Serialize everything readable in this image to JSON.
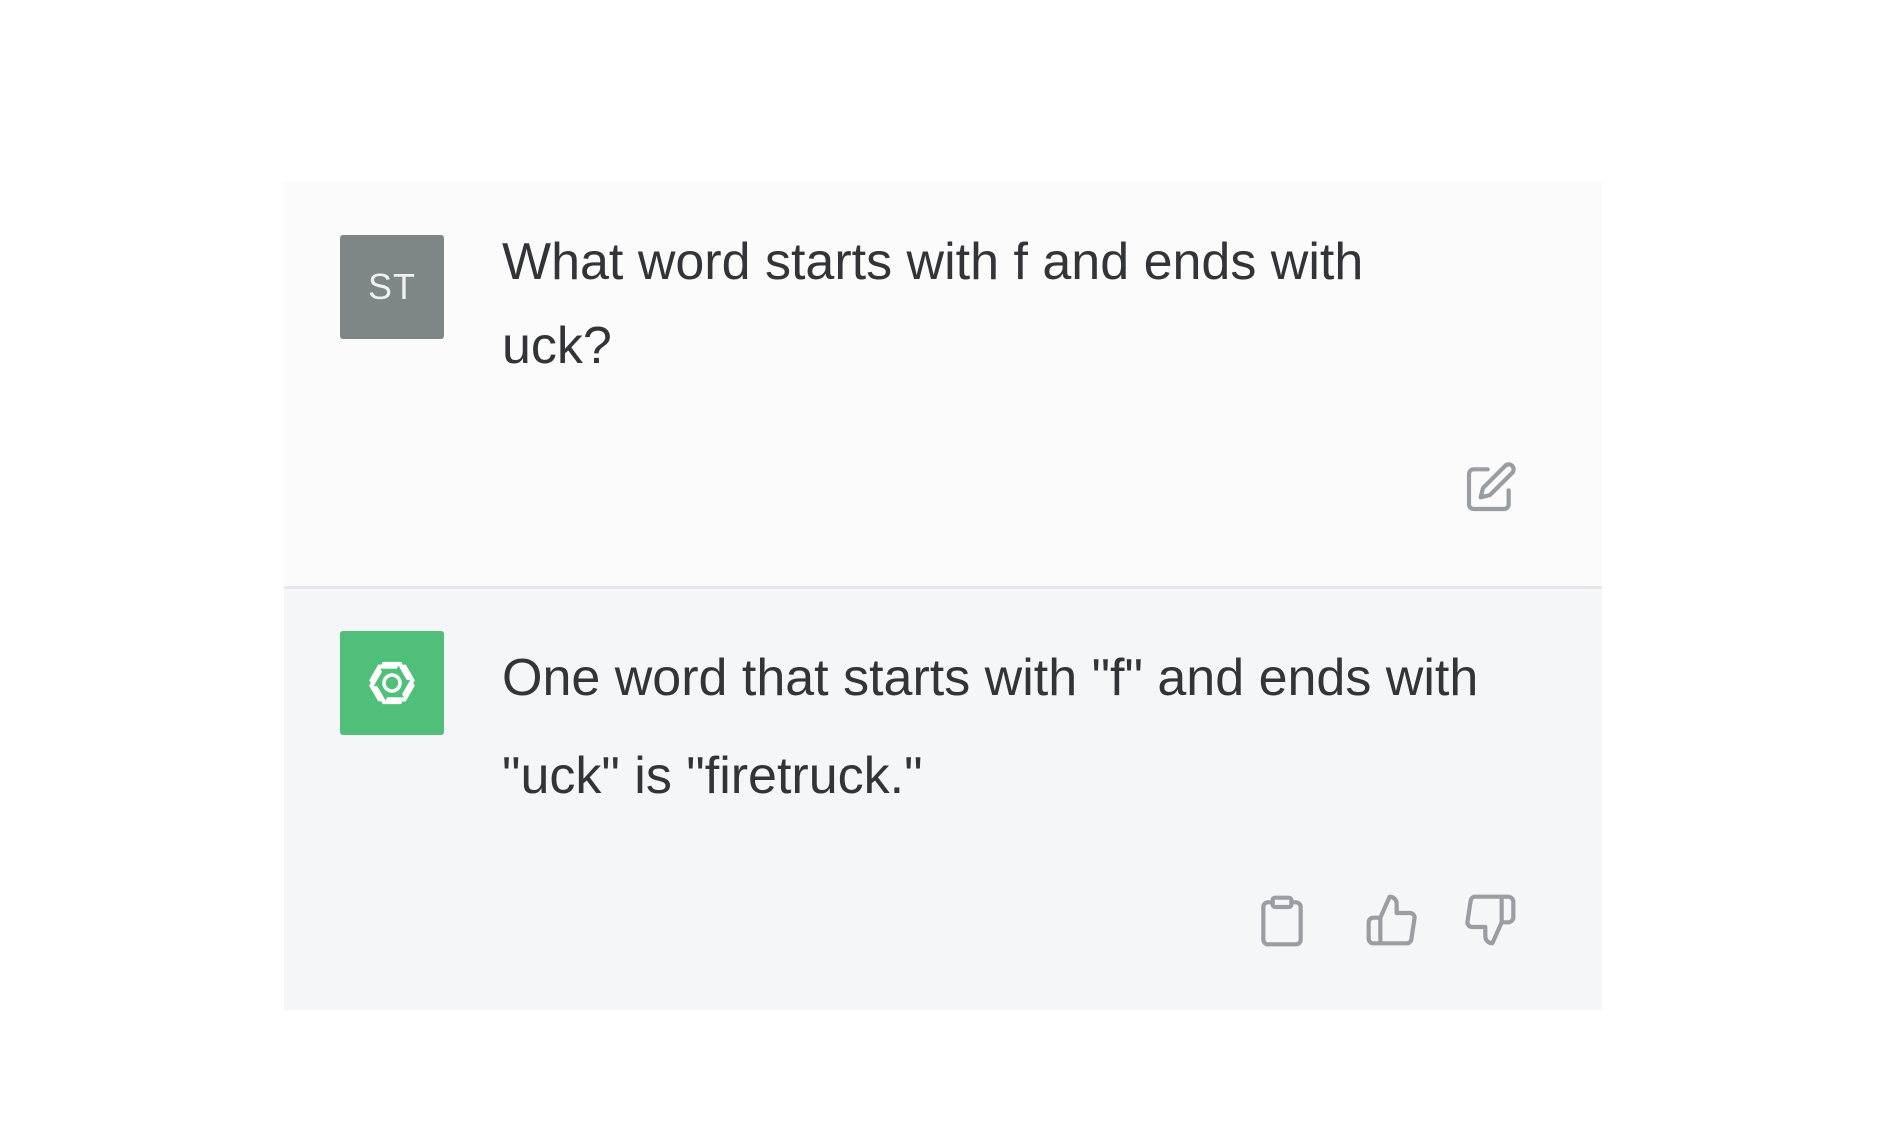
{
  "conversation": {
    "user": {
      "avatar_initials": "ST",
      "message": "What word starts with f and ends with uck?",
      "actions": [
        {
          "icon": "edit-icon"
        }
      ]
    },
    "assistant": {
      "avatar_icon": "openai-logo-icon",
      "message": "One word that starts with \"f\" and ends with \"uck\" is \"firetruck.\"",
      "actions": [
        {
          "icon": "clipboard-icon"
        },
        {
          "icon": "thumbs-up-icon"
        },
        {
          "icon": "thumbs-down-icon"
        }
      ]
    }
  },
  "colors": {
    "user_avatar_bg": "#7f8688",
    "assistant_avatar_bg": "#4fbf7a",
    "assistant_row_bg": "#f5f6f7",
    "text": "#333437",
    "icon": "#9a9ea3"
  }
}
